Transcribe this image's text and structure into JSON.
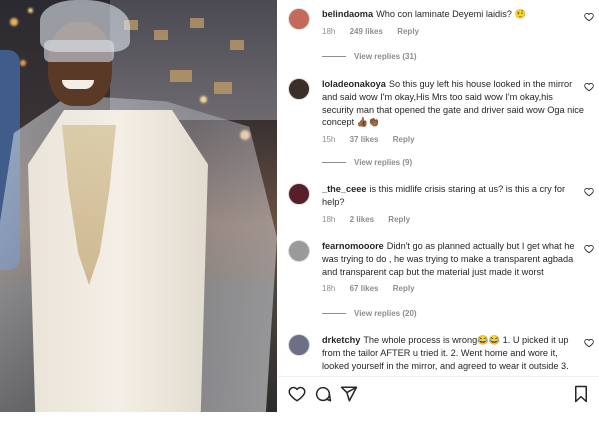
{
  "post": {
    "photo_alt": "Man wearing agbada covered in transparent plastic with a transparent cap"
  },
  "comments": [
    {
      "username": "belindaoma",
      "text": "Who con laminate Deyemi laidis? 🤨",
      "time": "18h",
      "likes": "249 likes",
      "reply": "Reply",
      "view_replies": "View replies (31)",
      "avatar_color": "#c46a5a"
    },
    {
      "username": "loladeonakoya",
      "text": "So this guy left his house looked in the mirror and said wow I'm okay,His Mrs too said wow I'm okay,his security man that opened the gate and driver said wow Oga nice concept 👍🏾👏🏾",
      "time": "15h",
      "likes": "37 likes",
      "reply": "Reply",
      "view_replies": "View replies (9)",
      "avatar_color": "#3a2f2a"
    },
    {
      "username": "_the_ceee",
      "text": "is this midlife crisis staring at us? is this a cry for help?",
      "time": "18h",
      "likes": "2 likes",
      "reply": "Reply",
      "avatar_color": "#5a1d2a"
    },
    {
      "username": "fearnomooore",
      "text": "Didn't go as planned actually but I get what he was trying to do , he was trying to make a transparent agbada and transparent cap but the material just made it worst",
      "time": "18h",
      "likes": "67 likes",
      "reply": "Reply",
      "view_replies": "View replies (20)",
      "avatar_color": "#9a9a9a"
    },
    {
      "username": "drketchy",
      "text": "The whole process is wrong😂😂 1. U picked it up from the tailor AFTER u tried it. 2. Went home and wore it, looked yourself in the mirror, and agreed to wear it outside 3.",
      "avatar_color": "#6c6f86"
    }
  ],
  "actions": {
    "like_icon": "heart-icon",
    "comment_icon": "comment-icon",
    "share_icon": "share-icon",
    "save_icon": "bookmark-icon"
  }
}
